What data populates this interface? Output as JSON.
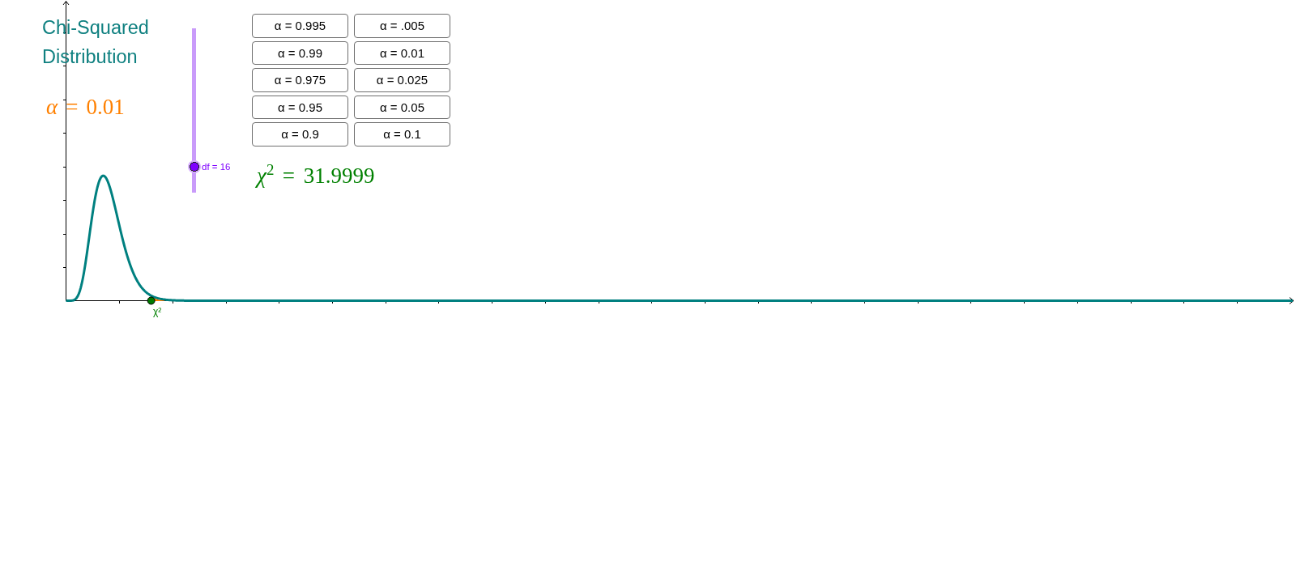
{
  "title": "Chi-Squared Distribution",
  "alpha_readout": "*α* = 0.01",
  "slider": {
    "label": "df = 16",
    "level": 0.16
  },
  "buttons": [
    {
      "label": "α = 0.995"
    },
    {
      "label": "α = .005"
    },
    {
      "label": "α = 0.99"
    },
    {
      "label": "α = 0.01"
    },
    {
      "label": "α = 0.975"
    },
    {
      "label": "α = 0.025"
    },
    {
      "label": "α = 0.95"
    },
    {
      "label": "α = 0.05"
    },
    {
      "label": "α = 0.9"
    },
    {
      "label": "α = 0.1"
    }
  ],
  "statistic": "*χ*$^{2}$ = 31.9999",
  "graph": {
    "point_label": "χ²"
  }
}
